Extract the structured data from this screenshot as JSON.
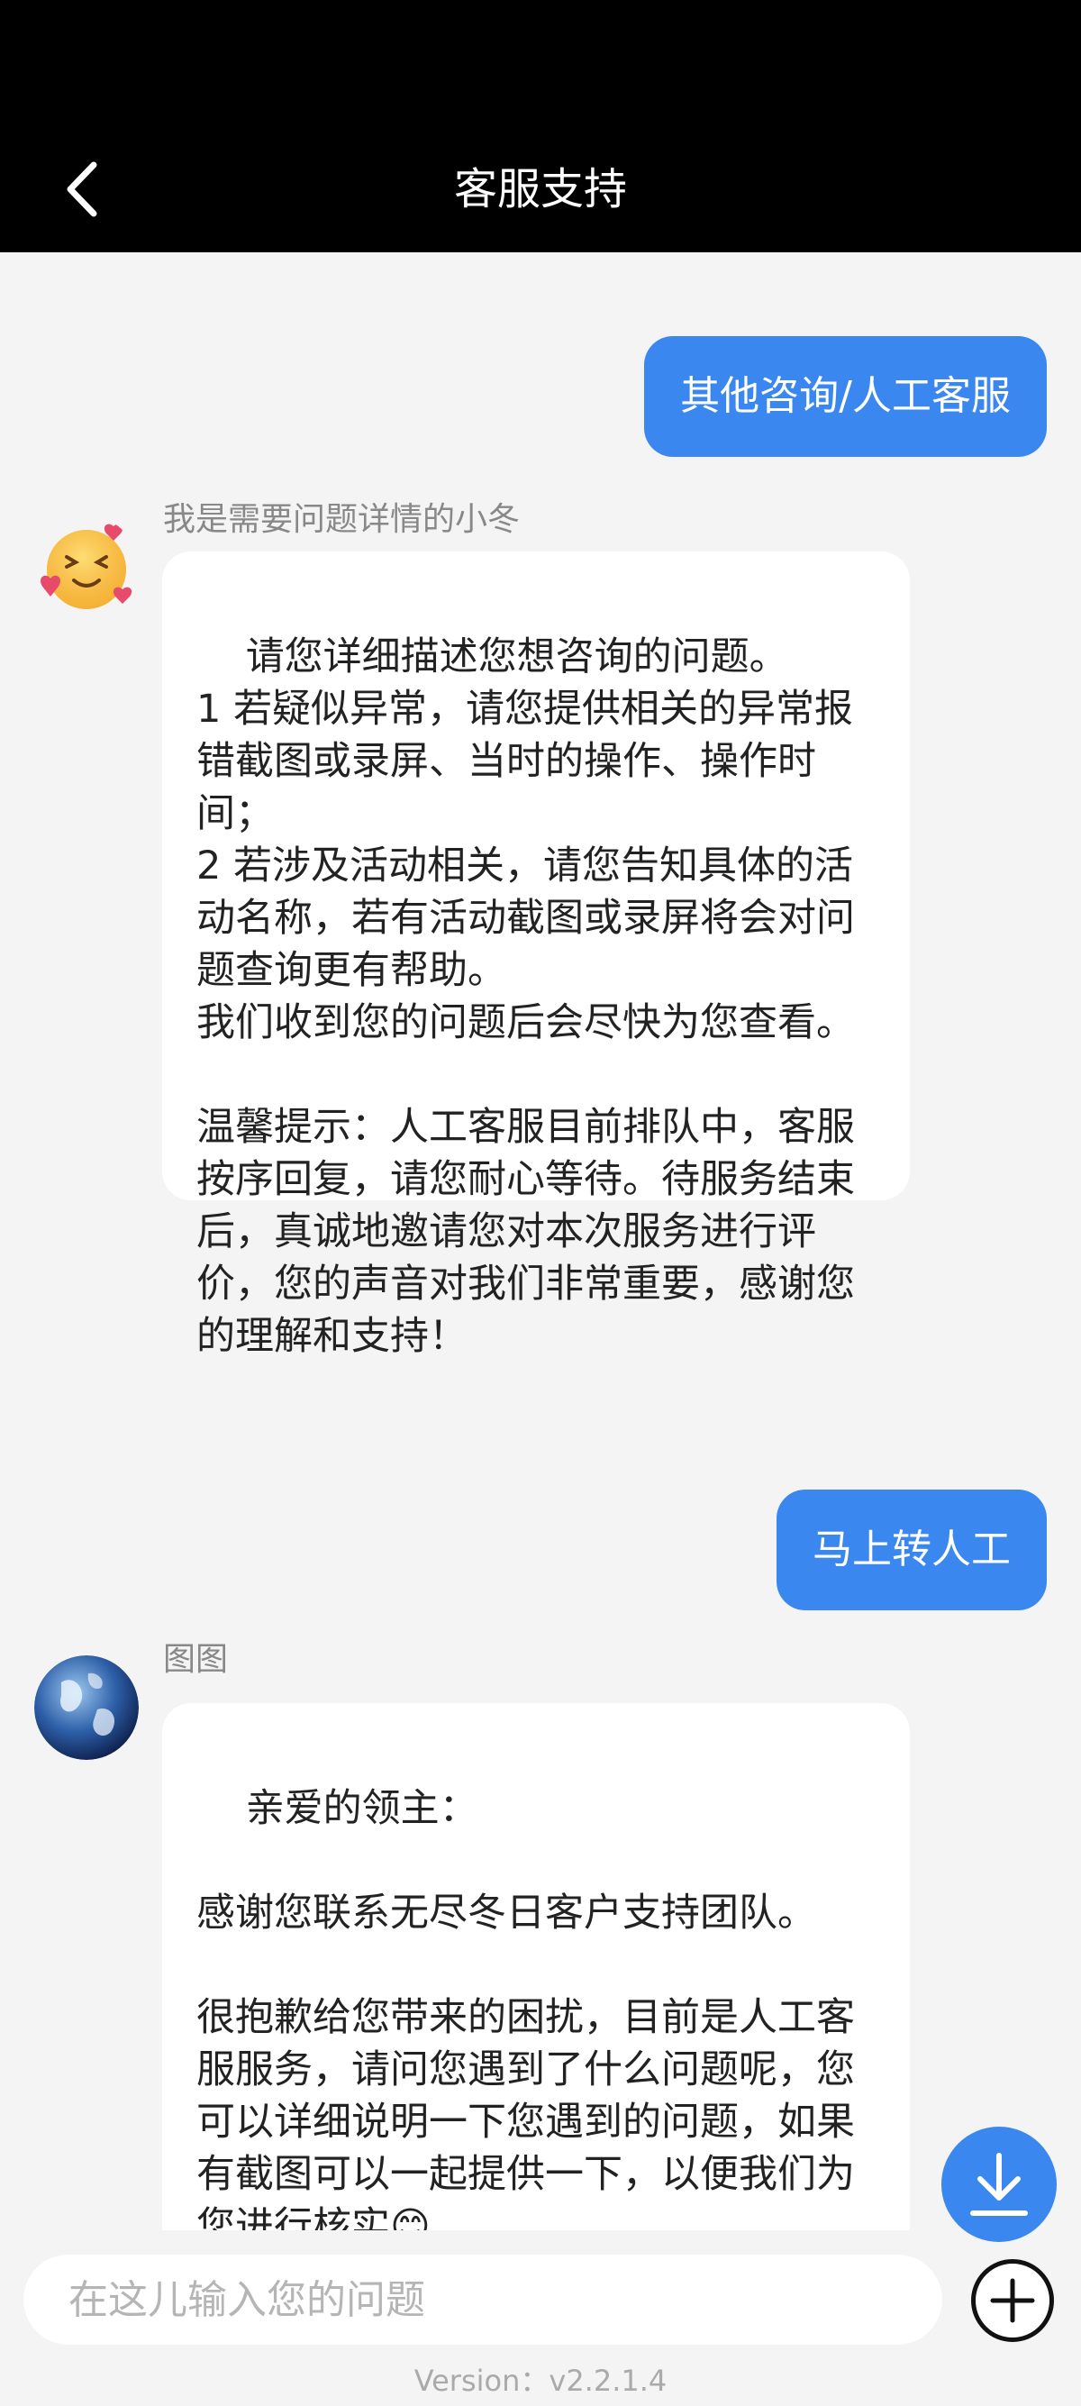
{
  "header": {
    "title": "客服支持",
    "back_icon": "chevron-left-icon"
  },
  "messages": [
    {
      "role": "user",
      "text": "其他咨询/人工客服"
    },
    {
      "role": "bot",
      "sender": "我是需要问题详情的小冬",
      "avatar": "smiling-face-with-hearts-avatar",
      "text": "请您详细描述您想咨询的问题。\n1 若疑似异常，请您提供相关的异常报错截图或录屏、当时的操作、操作时间；\n2 若涉及活动相关，请您告知具体的活动名称，若有活动截图或录屏将会对问题查询更有帮助。\n我们收到您的问题后会尽快为您查看。\n\n温馨提示：人工客服目前排队中，客服按序回复，请您耐心等待。待服务结束后，真诚地邀请您对本次服务进行评价，您的声音对我们非常重要，感谢您的理解和支持！"
    },
    {
      "role": "user",
      "text": "马上转人工"
    },
    {
      "role": "bot",
      "sender": "图图",
      "avatar": "earth-globe-avatar",
      "text": "亲爱的领主：\n\n感谢您联系无尽冬日客户支持团队。\n\n很抱歉给您带来的困扰，目前是人工客服服务，请问您遇到了什么问题呢，您可以详细说明一下您遇到的问题，如果有截图可以一起提供一下，以便我们为您进行核实😊"
    }
  ],
  "scroll_down_icon": "download-arrow-icon",
  "input": {
    "placeholder": "在这儿输入您的问题",
    "value": ""
  },
  "add_icon": "plus-circle-icon",
  "version": "Version：v2.2.1.4",
  "colors": {
    "header_bg": "#000000",
    "page_bg": "#f4f4f4",
    "accent": "#3b87f0",
    "bubble_bg": "#ffffff"
  }
}
